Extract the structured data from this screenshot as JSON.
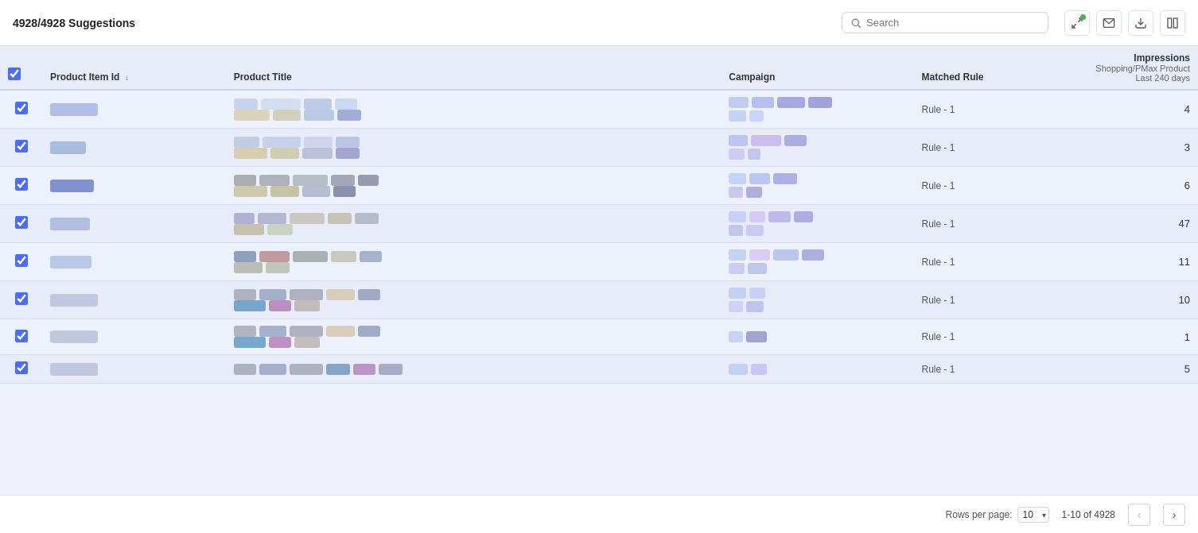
{
  "header": {
    "title": "4928/4928 Suggestions",
    "search_placeholder": "Search"
  },
  "toolbar_icons": [
    {
      "name": "fullscreen-icon",
      "unicode": "⛶"
    },
    {
      "name": "email-icon",
      "unicode": "✉"
    },
    {
      "name": "download-icon",
      "unicode": "⬇"
    },
    {
      "name": "columns-icon",
      "unicode": "⊞"
    }
  ],
  "table": {
    "columns": [
      {
        "key": "check",
        "label": ""
      },
      {
        "key": "id",
        "label": "Product Item Id",
        "sortable": true
      },
      {
        "key": "title",
        "label": "Product Title"
      },
      {
        "key": "campaign",
        "label": "Campaign"
      },
      {
        "key": "rule",
        "label": "Matched Rule"
      },
      {
        "key": "impressions",
        "label": "Impressions",
        "sub1": "Shopping/PMax Product",
        "sub2": "Last 240 days"
      }
    ],
    "rows": [
      {
        "id_color": "#b0bfea",
        "id_w": 60,
        "title_blocks": [
          [
            {
              "w": 30,
              "c": "#b8c8e8"
            },
            {
              "w": 50,
              "c": "#c8d8f0"
            },
            {
              "w": 35,
              "c": "#a8bce0"
            },
            {
              "w": 28,
              "c": "#b8d0ee"
            }
          ],
          [
            {
              "w": 45,
              "c": "#d4c8a0"
            },
            {
              "w": 35,
              "c": "#c8c0a0"
            },
            {
              "w": 38,
              "c": "#a8b8d8"
            },
            {
              "w": 30,
              "c": "#8090c8"
            }
          ]
        ],
        "camp_lines": [
          [
            {
              "w": 25,
              "c": "#b0c0f0"
            },
            {
              "w": 28,
              "c": "#a0b0e8"
            },
            {
              "w": 35,
              "c": "#9090d8"
            },
            {
              "w": 30,
              "c": "#8888d0"
            }
          ],
          [
            {
              "w": 22,
              "c": "#b8c8f8"
            },
            {
              "w": 18,
              "c": "#c0c8f8"
            }
          ]
        ],
        "rule": "Rule - 1",
        "impressions": "4"
      },
      {
        "id_color": "#a8bce0",
        "id_w": 45,
        "title_blocks": [
          [
            {
              "w": 32,
              "c": "#b0c0e0"
            },
            {
              "w": 48,
              "c": "#b8c8e8"
            },
            {
              "w": 36,
              "c": "#c0cce8"
            },
            {
              "w": 30,
              "c": "#a8b8d8"
            }
          ],
          [
            {
              "w": 42,
              "c": "#d0c090"
            },
            {
              "w": 36,
              "c": "#c8c090"
            },
            {
              "w": 38,
              "c": "#a8b0cc"
            },
            {
              "w": 30,
              "c": "#8888c0"
            }
          ]
        ],
        "camp_lines": [
          [
            {
              "w": 24,
              "c": "#b0b8f0"
            },
            {
              "w": 38,
              "c": "#c0b0e8"
            },
            {
              "w": 28,
              "c": "#9898d8"
            }
          ],
          [
            {
              "w": 20,
              "c": "#c8c0f0"
            },
            {
              "w": 16,
              "c": "#b8b8e8"
            }
          ]
        ],
        "rule": "Rule - 1",
        "impressions": "3"
      },
      {
        "id_color": "#8090d0",
        "id_w": 55,
        "title_blocks": [
          [
            {
              "w": 28,
              "c": "#909090"
            },
            {
              "w": 38,
              "c": "#9898a0"
            },
            {
              "w": 44,
              "c": "#a0a8b0"
            },
            {
              "w": 30,
              "c": "#8888a0"
            },
            {
              "w": 26,
              "c": "#707890"
            }
          ],
          [
            {
              "w": 42,
              "c": "#c0b888"
            },
            {
              "w": 36,
              "c": "#b8b080"
            },
            {
              "w": 35,
              "c": "#a0aac0"
            },
            {
              "w": 28,
              "c": "#606888"
            }
          ]
        ],
        "camp_lines": [
          [
            {
              "w": 22,
              "c": "#b8c8f8"
            },
            {
              "w": 26,
              "c": "#a8b8f0"
            },
            {
              "w": 30,
              "c": "#9898e0"
            }
          ],
          [
            {
              "w": 18,
              "c": "#c0b8e8"
            },
            {
              "w": 20,
              "c": "#9898d0"
            }
          ]
        ],
        "rule": "Rule - 1",
        "impressions": "6"
      },
      {
        "id_color": "#b0c0e0",
        "id_w": 50,
        "title_blocks": [
          [
            {
              "w": 26,
              "c": "#9898c8"
            },
            {
              "w": 36,
              "c": "#a0a0c0"
            },
            {
              "w": 44,
              "c": "#c0b8a8"
            },
            {
              "w": 30,
              "c": "#b8b098"
            },
            {
              "w": 30,
              "c": "#a0a8b8"
            }
          ],
          [
            {
              "w": 38,
              "c": "#b8b090"
            },
            {
              "w": 32,
              "c": "#c0c8a8"
            }
          ]
        ],
        "camp_lines": [
          [
            {
              "w": 22,
              "c": "#c0c8f8"
            },
            {
              "w": 20,
              "c": "#d0c0f0"
            },
            {
              "w": 28,
              "c": "#b0a8e8"
            },
            {
              "w": 24,
              "c": "#9898d8"
            }
          ],
          [
            {
              "w": 18,
              "c": "#b8b8e8"
            },
            {
              "w": 22,
              "c": "#c0c0f0"
            }
          ]
        ],
        "rule": "Rule - 1",
        "impressions": "47"
      },
      {
        "id_color": "#b8c8e8",
        "id_w": 52,
        "title_blocks": [
          [
            {
              "w": 28,
              "c": "#6080a0"
            },
            {
              "w": 38,
              "c": "#b07878"
            },
            {
              "w": 44,
              "c": "#909898"
            },
            {
              "w": 32,
              "c": "#b8b8a0"
            },
            {
              "w": 28,
              "c": "#8898b8"
            }
          ],
          [
            {
              "w": 36,
              "c": "#a8a898"
            },
            {
              "w": 30,
              "c": "#b0b0a0"
            }
          ]
        ],
        "camp_lines": [
          [
            {
              "w": 22,
              "c": "#b8c8f0"
            },
            {
              "w": 26,
              "c": "#d0c0f0"
            },
            {
              "w": 32,
              "c": "#a8b8e8"
            },
            {
              "w": 28,
              "c": "#9898d8"
            }
          ],
          [
            {
              "w": 20,
              "c": "#c0c0f0"
            },
            {
              "w": 24,
              "c": "#b0b8e8"
            }
          ]
        ],
        "rule": "Rule - 1",
        "impressions": "11"
      },
      {
        "id_color": "#c0c8e0",
        "id_w": 60,
        "title_blocks": [
          [
            {
              "w": 28,
              "c": "#9898a8"
            },
            {
              "w": 34,
              "c": "#8898b8"
            },
            {
              "w": 42,
              "c": "#9898a8"
            },
            {
              "w": 36,
              "c": "#d0c0a0"
            },
            {
              "w": 28,
              "c": "#8090b0"
            }
          ],
          [
            {
              "w": 40,
              "c": "#4888b8"
            },
            {
              "w": 28,
              "c": "#a868a8"
            },
            {
              "w": 32,
              "c": "#b0a8a0"
            }
          ]
        ],
        "camp_lines": [
          [
            {
              "w": 22,
              "c": "#b8c8f0"
            },
            {
              "w": 20,
              "c": "#c0c8f8"
            }
          ],
          [
            {
              "w": 18,
              "c": "#c8c8f8"
            },
            {
              "w": 22,
              "c": "#b0b8e8"
            }
          ]
        ],
        "rule": "Rule - 1",
        "impressions": "10"
      },
      {
        "id_color": "#c0c8e0",
        "id_w": 60,
        "title_blocks": [
          [
            {
              "w": 28,
              "c": "#9898a8"
            },
            {
              "w": 34,
              "c": "#8898b8"
            },
            {
              "w": 42,
              "c": "#9898a8"
            },
            {
              "w": 36,
              "c": "#d0c0a0"
            },
            {
              "w": 28,
              "c": "#8090b0"
            }
          ],
          [
            {
              "w": 40,
              "c": "#4888b8"
            },
            {
              "w": 28,
              "c": "#a868a8"
            },
            {
              "w": 32,
              "c": "#b0a8a0"
            }
          ]
        ],
        "camp_lines": [
          [
            {
              "w": 18,
              "c": "#b8c8f0"
            },
            {
              "w": 26,
              "c": "#8888c0"
            }
          ],
          []
        ],
        "rule": "Rule - 1",
        "impressions": "1"
      },
      {
        "id_color": "#c0c8e0",
        "id_w": 60,
        "title_blocks": [
          [
            {
              "w": 28,
              "c": "#9898a8"
            },
            {
              "w": 34,
              "c": "#8898b8"
            },
            {
              "w": 42,
              "c": "#9898a8"
            },
            {
              "w": 30,
              "c": "#5888b0"
            },
            {
              "w": 28,
              "c": "#a870b0"
            },
            {
              "w": 30,
              "c": "#9090b0"
            }
          ],
          []
        ],
        "camp_lines": [
          [
            {
              "w": 24,
              "c": "#b8c8f0"
            },
            {
              "w": 20,
              "c": "#c0b8f0"
            }
          ],
          []
        ],
        "rule": "Rule - 1",
        "impressions": "5"
      }
    ]
  },
  "footer": {
    "rows_per_page_label": "Rows per page:",
    "rows_per_page_value": "10",
    "pagination_info": "1-10 of 4928",
    "prev_disabled": true,
    "next_disabled": false
  }
}
